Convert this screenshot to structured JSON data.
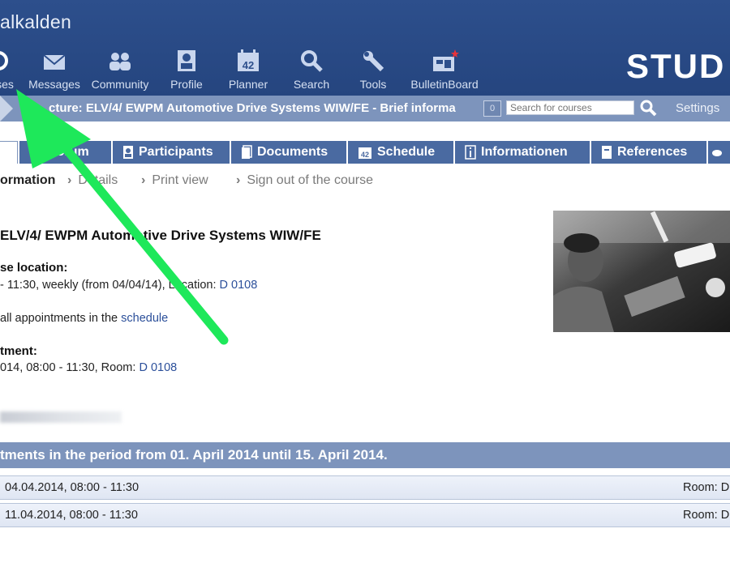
{
  "header": {
    "site_title": "alkalden",
    "brand": "STUD",
    "nav": [
      {
        "label": "ses",
        "icon": "courses-icon"
      },
      {
        "label": "Messages",
        "icon": "envelope-icon"
      },
      {
        "label": "Community",
        "icon": "people-icon"
      },
      {
        "label": "Profile",
        "icon": "profile-icon"
      },
      {
        "label": "Planner",
        "icon": "calendar-icon",
        "icon_text": "42"
      },
      {
        "label": "Search",
        "icon": "magnifier-icon"
      },
      {
        "label": "Tools",
        "icon": "wrench-icon"
      },
      {
        "label": "BulletinBoard",
        "icon": "bulletin-board-icon"
      }
    ]
  },
  "breadcrumb": {
    "text": "cture: ELV/4/ EWPM Automotive Drive Systems WIW/FE - Brief informa",
    "count": "0",
    "search_placeholder": "Search for courses",
    "settings_label": "Settings"
  },
  "tabs": [
    {
      "label": "",
      "icon": "none",
      "active": true
    },
    {
      "label": "Forum",
      "icon": "speech-bubble-icon"
    },
    {
      "label": "Participants",
      "icon": "participants-icon"
    },
    {
      "label": "Documents",
      "icon": "documents-icon"
    },
    {
      "label": "Schedule",
      "icon": "calendar-icon",
      "icon_text": "42"
    },
    {
      "label": "Informationen",
      "icon": "info-icon"
    },
    {
      "label": "References",
      "icon": "book-icon"
    },
    {
      "label": "",
      "icon": "more-icon"
    }
  ],
  "subnav": [
    {
      "label": "ormation",
      "active": true
    },
    {
      "label": "Details"
    },
    {
      "label": "Print view"
    },
    {
      "label": "Sign out of the course"
    }
  ],
  "content": {
    "course_title": "ELV/4/ EWPM Automotive Drive Systems WIW/FE",
    "time_location_heading": "se location:",
    "time_location_text": " - 11:30, weekly (from 04/04/14), Location: ",
    "time_location_room": "D 0108",
    "schedule_prefix": " all appointments in the ",
    "schedule_link": "schedule",
    "next_appointment_heading": "tment:",
    "next_appointment_text": "014, 08:00 - 11:30, Room: ",
    "next_appointment_room": "D 0108"
  },
  "appointments": {
    "heading": "tments in the period from 01. April 2014 until 15. April 2014.",
    "rows": [
      {
        "date": "04.04.2014, 08:00 - 11:30",
        "room": "Room: D"
      },
      {
        "date": "11.04.2014, 08:00 - 11:30",
        "room": "Room: D"
      }
    ]
  },
  "colors": {
    "header_blue": "#2d4f8c",
    "bar_blue": "#7d94bc",
    "tab_blue": "#4a6aa1",
    "link_blue": "#2b4f9a",
    "annotation_arrow": "#1ee85a"
  }
}
